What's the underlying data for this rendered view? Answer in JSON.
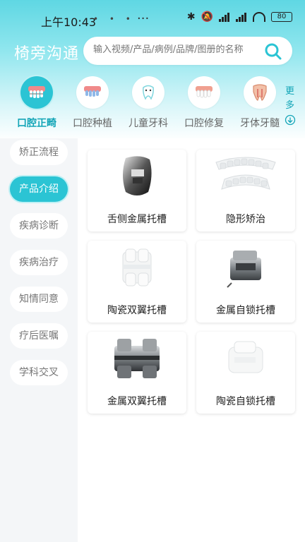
{
  "status": {
    "time": "上午10:43",
    "battery": "80"
  },
  "header": {
    "title": "椅旁沟通",
    "search_placeholder": "输入视频/产品/病例/品牌/图册的名称"
  },
  "categories": [
    {
      "label": "口腔正畸",
      "icon": "braces-teeth-icon",
      "active": true
    },
    {
      "label": "口腔种植",
      "icon": "implant-teeth-icon",
      "active": false
    },
    {
      "label": "儿童牙科",
      "icon": "child-tooth-icon",
      "active": false
    },
    {
      "label": "口腔修复",
      "icon": "restoration-teeth-icon",
      "active": false
    },
    {
      "label": "牙体牙髓",
      "icon": "endodontic-teeth-icon",
      "active": false
    }
  ],
  "more_label": "更多",
  "sidebar": {
    "items": [
      {
        "label": "矫正流程",
        "active": false
      },
      {
        "label": "产品介绍",
        "active": true
      },
      {
        "label": "疾病诊断",
        "active": false
      },
      {
        "label": "疾病治疗",
        "active": false
      },
      {
        "label": "知情同意",
        "active": false
      },
      {
        "label": "疗后医嘱",
        "active": false
      },
      {
        "label": "学科交叉",
        "active": false
      }
    ]
  },
  "products": [
    {
      "label": "舌侧金属托槽",
      "icon": "lingual-bracket-icon"
    },
    {
      "label": "隐形矫治",
      "icon": "clear-aligner-icon"
    },
    {
      "label": "陶瓷双翼托槽",
      "icon": "ceramic-twin-bracket-icon"
    },
    {
      "label": "金属自锁托槽",
      "icon": "metal-self-ligating-bracket-icon"
    },
    {
      "label": "金属双翼托槽",
      "icon": "metal-twin-bracket-icon"
    },
    {
      "label": "陶瓷自锁托槽",
      "icon": "ceramic-self-ligating-bracket-icon"
    }
  ],
  "colors": {
    "accent": "#2bc4d4",
    "accent_text": "#13a5b7"
  }
}
